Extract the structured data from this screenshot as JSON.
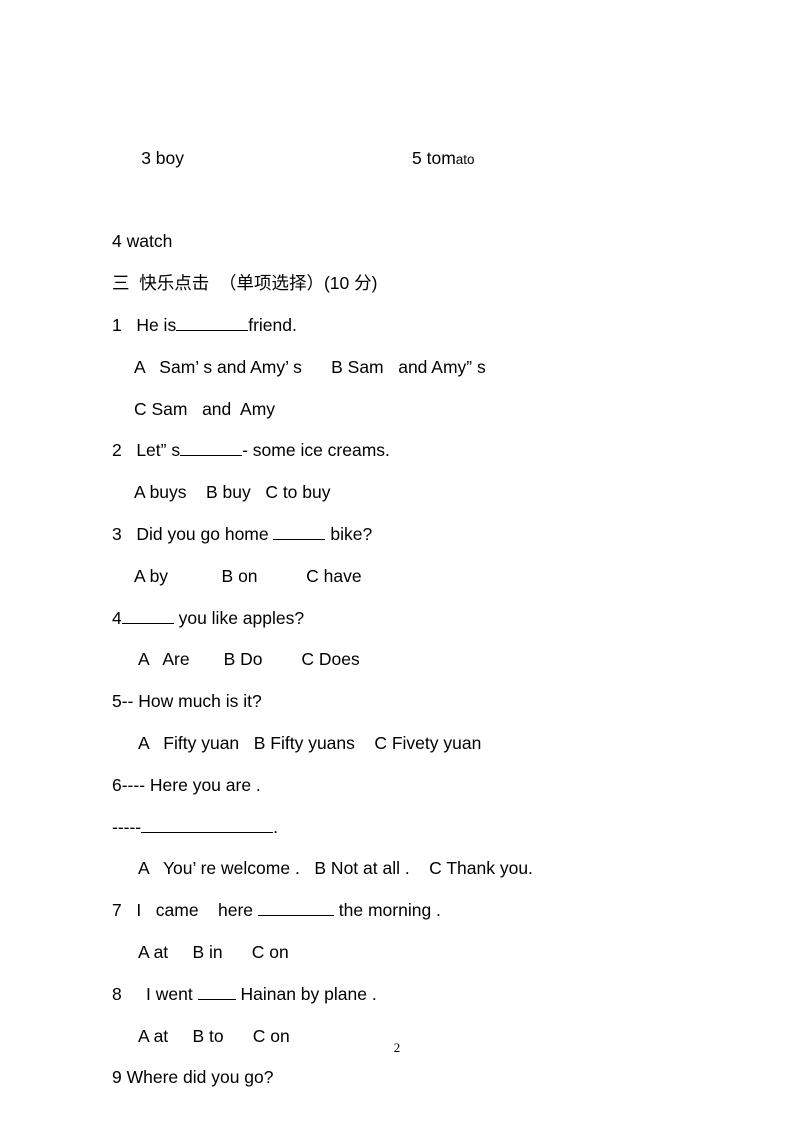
{
  "document": {
    "page_number": "2",
    "lines": {
      "vocab_3": "3 boy",
      "vocab_5_main": "5 tom",
      "vocab_5_small": "ato",
      "vocab_4": "4 watch",
      "section_heading": "三  快乐点击  （单项选择）(10 分)"
    },
    "questions": [
      {
        "id": "q1",
        "stem_before": "1   He is",
        "stem_after": "friend.",
        "options_lines": [
          "A   Sam’ s and Amy’ s      B Sam   and Amy” s",
          "C Sam   and  Amy"
        ]
      },
      {
        "id": "q2",
        "stem_before": "2   Let” s",
        "stem_after": "- some ice creams.",
        "options_lines": [
          "A buys    B buy   C to buy"
        ]
      },
      {
        "id": "q3",
        "stem_before": "3   Did you go home ",
        "stem_after": " bike?",
        "options_lines": [
          "A by           B on          C have"
        ]
      },
      {
        "id": "q4",
        "stem_before": "4",
        "stem_after": " you like apples?",
        "options_lines": [
          "A   Are       B Do        C Does"
        ]
      },
      {
        "id": "q5",
        "stem_before": "5-- How much is it?",
        "stem_after": "",
        "options_lines": [
          "A   Fifty yuan   B Fifty yuans    C Fivety yuan"
        ]
      },
      {
        "id": "q6",
        "stem_before": "6---- Here you are .",
        "stem_after": "",
        "sub_line_prefix": "-----",
        "sub_line_suffix": ".",
        "options_lines": [
          "A   You’ re welcome .   B Not at all .    C Thank you."
        ]
      },
      {
        "id": "q7",
        "stem_before": "7   I   came    here ",
        "stem_after": " the morning .",
        "options_lines": [
          "A at     B in      C on"
        ]
      },
      {
        "id": "q8",
        "stem_before": "8     I went ",
        "stem_after": " Hainan by plane .",
        "options_lines": [
          "A at     B to      C on"
        ]
      },
      {
        "id": "q9",
        "stem_before": "9 Where did you go?",
        "stem_after": "",
        "options_lines": []
      }
    ]
  }
}
